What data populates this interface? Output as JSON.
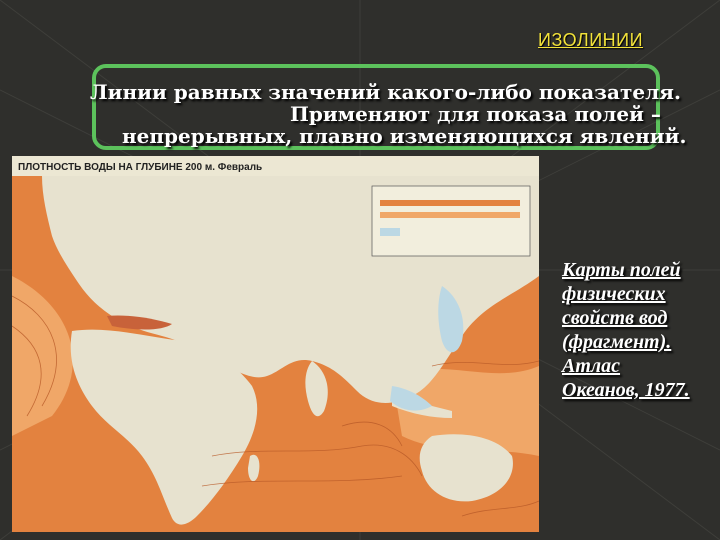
{
  "slide": {
    "title": "ИЗОЛИНИИ",
    "definition_lines": [
      "Линии равных значений какого-либо показателя.",
      "Применяют для показа полей –",
      "непрерывных, плавно изменяющихся явлений."
    ]
  },
  "map": {
    "header": "ПЛОТНОСТЬ ВОДЫ НА ГЛУБИНЕ 200 м. Февраль"
  },
  "caption": {
    "lines": [
      "Карты полей",
      "физических",
      "свойств вод",
      "(фрагмент).",
      "Атлас",
      "Океанов, 1977."
    ]
  },
  "colors": {
    "background": "#2f2f2c",
    "title": "#f2e23a",
    "box_border": "#5cc25c",
    "land": "#e7e2cf",
    "ocean_orange": "#e3823f",
    "ocean_light": "#f0a768",
    "shallow_blue": "#bcd8e4"
  }
}
